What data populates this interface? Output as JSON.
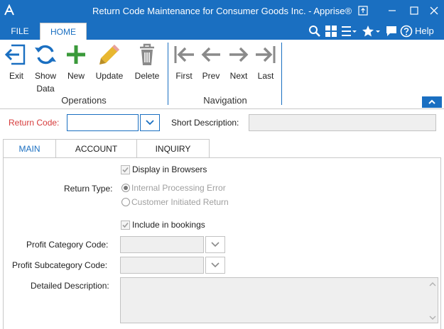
{
  "window": {
    "title": "Return Code Maintenance for Consumer Goods Inc. - Apprise®"
  },
  "ribbon_tabs": {
    "file": "FILE",
    "home": "HOME",
    "help": "Help"
  },
  "ribbon": {
    "operations": {
      "label": "Operations",
      "exit": "Exit",
      "show_data_line1": "Show",
      "show_data_line2": "Data",
      "new": "New",
      "update": "Update",
      "delete": "Delete"
    },
    "navigation": {
      "label": "Navigation",
      "first": "First",
      "prev": "Prev",
      "next": "Next",
      "last": "Last"
    }
  },
  "form": {
    "return_code_label": "Return Code:",
    "return_code_value": "",
    "short_description_label": "Short Description:",
    "short_description_value": ""
  },
  "tabs": {
    "main": "MAIN",
    "account": "ACCOUNT",
    "inquiry": "INQUIRY"
  },
  "main_tab": {
    "display_in_browsers": "Display in Browsers",
    "return_type_label": "Return Type:",
    "return_type_options": [
      "Internal Processing Error",
      "Customer Initiated Return"
    ],
    "include_in_bookings": "Include in bookings",
    "profit_category_label": "Profit Category Code:",
    "profit_category_value": "",
    "profit_subcategory_label": "Profit Subcategory Code:",
    "profit_subcategory_value": "",
    "detailed_description_label": "Detailed Description:",
    "detailed_description_value": ""
  },
  "colors": {
    "accent": "#1a6fc1",
    "required_label": "#d63b3b",
    "new_icon": "#3a9a3a",
    "update_icon": "#e8b730",
    "disabled_icon": "#8a8a8a"
  }
}
